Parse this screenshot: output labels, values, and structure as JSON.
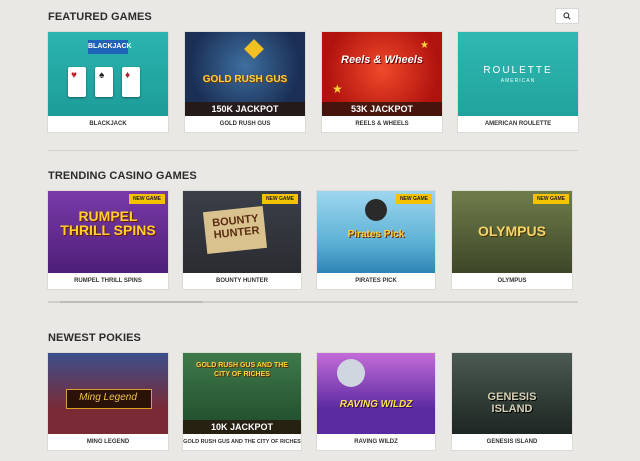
{
  "featured": {
    "title": "FEATURED GAMES",
    "cards": [
      {
        "name": "BLACKJACK",
        "art": "BLACKJACK",
        "jackpot": ""
      },
      {
        "name": "GOLD RUSH GUS",
        "art": "GOLD RUSH GUS",
        "jackpot": "150K JACKPOT"
      },
      {
        "name": "REELS & WHEELS",
        "art": "Reels & Wheels",
        "jackpot": "53K JACKPOT"
      },
      {
        "name": "AMERICAN ROULETTE",
        "art": "ROULETTE",
        "art_sub": "AMERICAN",
        "jackpot": ""
      }
    ]
  },
  "trending": {
    "title": "TRENDING CASINO GAMES",
    "badge": "NEW GAME",
    "cards": [
      {
        "name": "RUMPEL THRILL SPINS",
        "art": "RUMPEL THRILL SPINS"
      },
      {
        "name": "BOUNTY HUNTER",
        "art": "BOUNTY HUNTER"
      },
      {
        "name": "PIRATES PICK",
        "art": "Pirates Pick"
      },
      {
        "name": "OLYMPUS",
        "art": "OLYMPUS"
      }
    ]
  },
  "newest": {
    "title": "NEWEST POKIES",
    "cards": [
      {
        "name": "MING LEGEND",
        "art": "Ming Legend",
        "jackpot": ""
      },
      {
        "name": "GOLD RUSH GUS AND THE CITY OF RICHES",
        "art": "GOLD RUSH GUS AND THE CITY OF RICHES",
        "jackpot": "10K JACKPOT"
      },
      {
        "name": "RAVING WILDZ",
        "art": "RAVING WILDZ",
        "jackpot": ""
      },
      {
        "name": "GENESIS ISLAND",
        "art": "GENESIS ISLAND",
        "jackpot": ""
      }
    ]
  },
  "icons": {
    "search": "search-icon"
  },
  "colors": {
    "background": "#e9e8e4",
    "badge": "#f5c200",
    "caption_text": "#333333"
  }
}
